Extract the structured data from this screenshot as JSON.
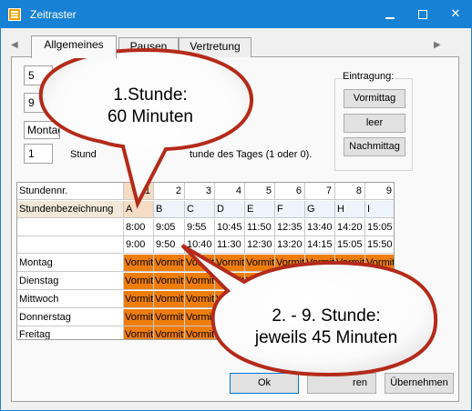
{
  "window": {
    "title": "Zeitraster"
  },
  "tabs": [
    {
      "label": "Allgemeines"
    },
    {
      "label": "Pausen"
    },
    {
      "label": "Vertretung"
    }
  ],
  "fields": {
    "field1": "5",
    "field2": "9",
    "combo": "Montag",
    "field3": "1",
    "field3_label_left": "Stund",
    "field3_label_right": "tunde des Tages (1 oder 0)."
  },
  "entry_group": {
    "label": "Eintragung:",
    "buttons": [
      "Vormittag",
      "leer",
      "Nachmittag"
    ]
  },
  "grid": {
    "header_label": "Stundennr.",
    "name_label": "Stundenbezeichnung",
    "periods": [
      "1",
      "2",
      "3",
      "4",
      "5",
      "6",
      "7",
      "8",
      "9"
    ],
    "names": [
      "A",
      "B",
      "C",
      "D",
      "E",
      "F",
      "G",
      "H",
      "I"
    ],
    "starts": [
      "8:00",
      "9:05",
      "9:55",
      "10:45",
      "11:50",
      "12:35",
      "13:40",
      "14:20",
      "15:05"
    ],
    "ends": [
      "9:00",
      "9:50",
      "10:40",
      "11:30",
      "12:30",
      "13:20",
      "14:15",
      "15:05",
      "15:50"
    ],
    "days": [
      "Montag",
      "Dienstag",
      "Mittwoch",
      "Donnerstag",
      "Freitag"
    ],
    "cell_value": "Vormittag"
  },
  "bottom_buttons": {
    "ok": "Ok",
    "cancel_partial": "ren",
    "apply": "Übernehmen"
  },
  "callouts": {
    "first": {
      "line1": "1.Stunde:",
      "line2": "60 Minuten"
    },
    "second": {
      "line1": "2. - 9. Stunde:",
      "line2": "jeweils 45 Minuten"
    }
  }
}
